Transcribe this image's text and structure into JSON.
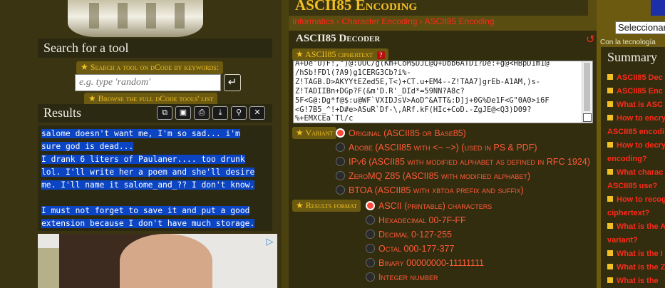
{
  "left": {
    "search": {
      "title": "Search for a tool",
      "hint": "Search a tool on dCode by keywords:",
      "placeholder": "e.g. type 'random'",
      "submit_label": "↵",
      "browse": "Browse the full dCode tools' list"
    },
    "results": {
      "title": "Results",
      "lines": [
        "salome doesn't want me, I'm so sad... i'm",
        "sure god is dead...",
        "I drank 6 liters of Paulaner.... too drunk",
        "lol. I'll write her a poem and she'll desire",
        "me. I'll name it salome_and_?? I don't know.",
        "",
        "I must not forget to save it and put a good",
        "extension because I don't have much storage."
      ],
      "tools": [
        "⧉",
        "▣",
        "⎙",
        "⤓",
        "⚲",
        "✕"
      ],
      "tool_names": [
        "copy-icon",
        "save-icon",
        "print-icon",
        "download-icon",
        "pin-icon",
        "close-icon"
      ]
    },
    "ad_choice": "▷"
  },
  "main": {
    "page_title": "ASCII85 Encoding",
    "breadcrumbs": [
      "Informatics",
      "Character Encoding",
      "ASCII85 Encoding"
    ],
    "decoder": {
      "title": "ASCII85 Decoder",
      "ciphertext_label": "ASCII85 ciphertext",
      "help": "?",
      "ciphertext": "A+De'U)F!,\")@:OUC/g(Km+CoM$DJL@Q+Dbb6ATD1?De:+g@<HBpD1m1@\n/hSb!FDl(?A9)g1CERG3Cb?i%-\nZ!TAGB.D>AKYYtEZed5E,T<)+CT.u+EM4--Z!TAA7]grEb-A1AM,)s-\nZ!TADIIBn+DGp?F(&m'D.R'_DId*=59NN?A8c?\n5F<G@:Dg*f@$:u@WF`VXIDJsV>AoD^&ATT&:D]j+0G%De1F<G\"0A0>i6F\n<G!7B5_^!+D#e>ASuR`Df-\\,ARf.kF(HIc+CoD.-ZgJE@<Q3)D09?\n%+EMXCEa`Tl/c",
      "variant_label": "Variant",
      "variants": [
        "Original (ASCII85 or Base85)",
        "Adobe (ASCII85 with <~ ~>) (used in PS & PDF)",
        "IPv6 (ASCII85 with modified alphabet as defined in RFC 1924)",
        "ZeroMQ Z85 (ASCII85 with modified alphabet)",
        "BTOA (ASCII85 with xbtoa prefix and suffix)"
      ],
      "variant_selected": 0,
      "format_label": "Results format",
      "formats": [
        "ASCII (printable) characters",
        "Hexadecimal 00-7F-FF",
        "Decimal 0-127-255",
        "Octal 000-177-377",
        "Binary 00000000-11111111",
        "Integer number"
      ],
      "format_selected": 0
    }
  },
  "right": {
    "language_select": "Seleccionar",
    "tech_note": "Con la tecnología",
    "summary_title": "Summary",
    "summary_items": [
      "ASCII85 Dec",
      "ASCII85 Enc",
      "What is ASC",
      "How to encry",
      "ASCII85 encodi",
      "How to decry",
      "encoding?",
      "What charac",
      "ASCII85 use?",
      "How to recog",
      "ciphertext?",
      "What is the A",
      "variant?",
      "What is the I",
      "What is the Z",
      "What is the "
    ]
  }
}
